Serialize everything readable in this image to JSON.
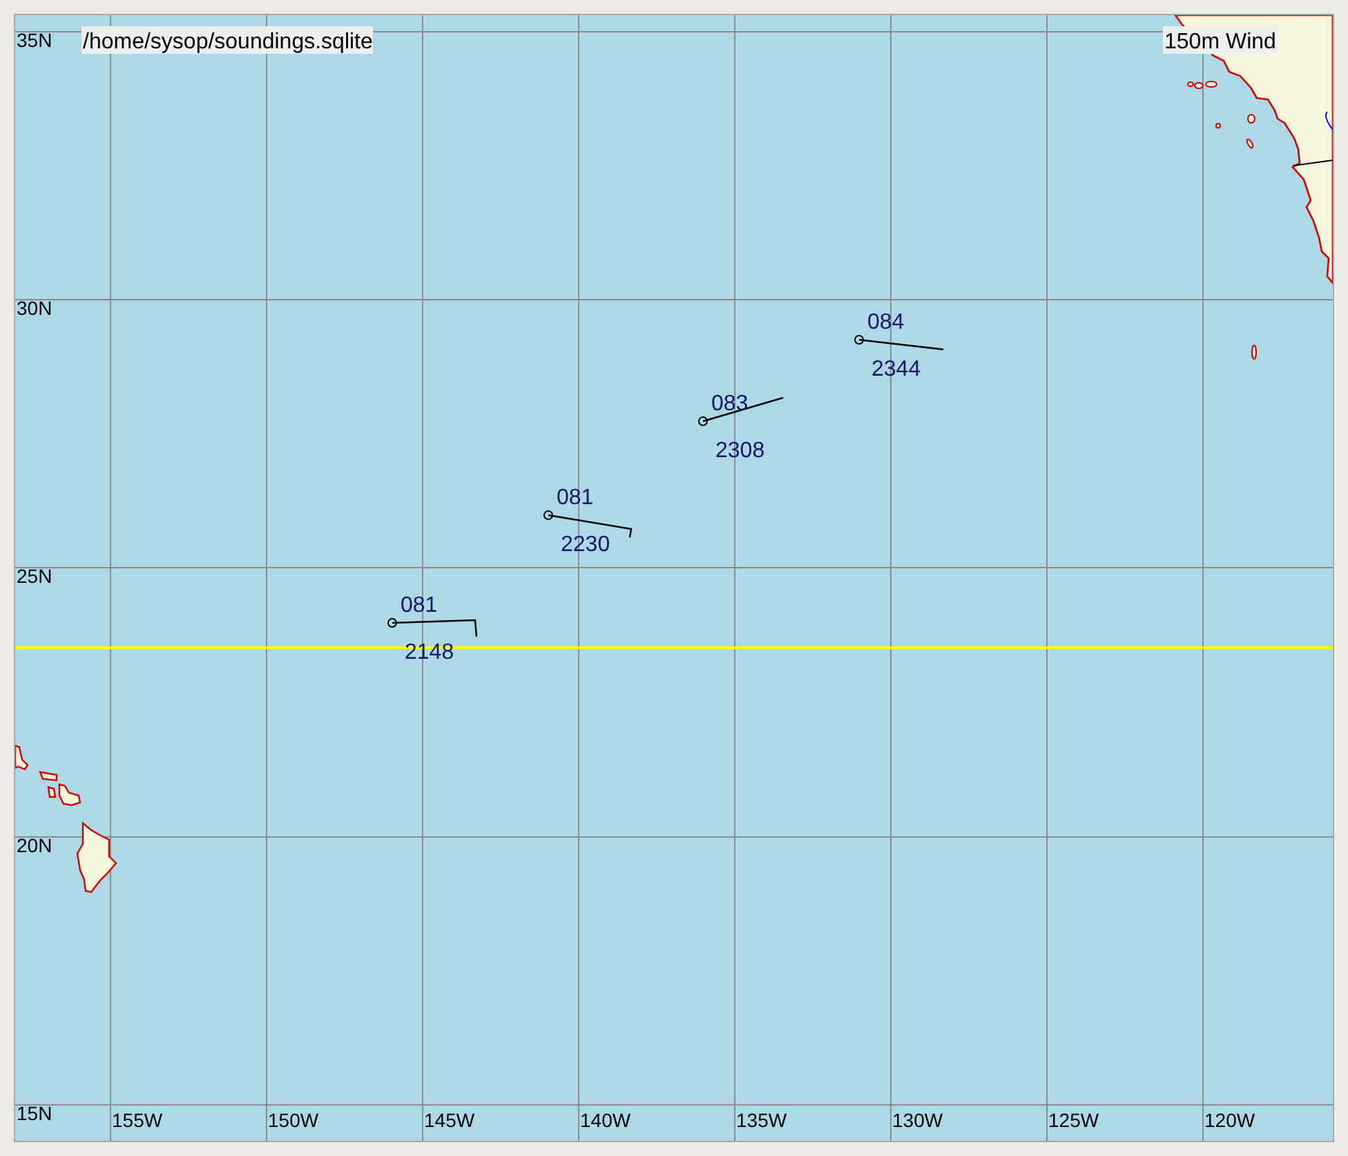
{
  "map": {
    "source": "/home/sysop/soundings.sqlite",
    "title": "150m Wind",
    "lat_labels": [
      "35N",
      "30N",
      "25N",
      "20N",
      "15N"
    ],
    "lon_labels": [
      "155W",
      "150W",
      "145W",
      "140W",
      "135W",
      "130W",
      "125W",
      "120W"
    ],
    "stations": [
      {
        "code": "081",
        "value": "2148"
      },
      {
        "code": "081",
        "value": "2230"
      },
      {
        "code": "083",
        "value": "2308"
      },
      {
        "code": "084",
        "value": "2344"
      }
    ]
  }
}
